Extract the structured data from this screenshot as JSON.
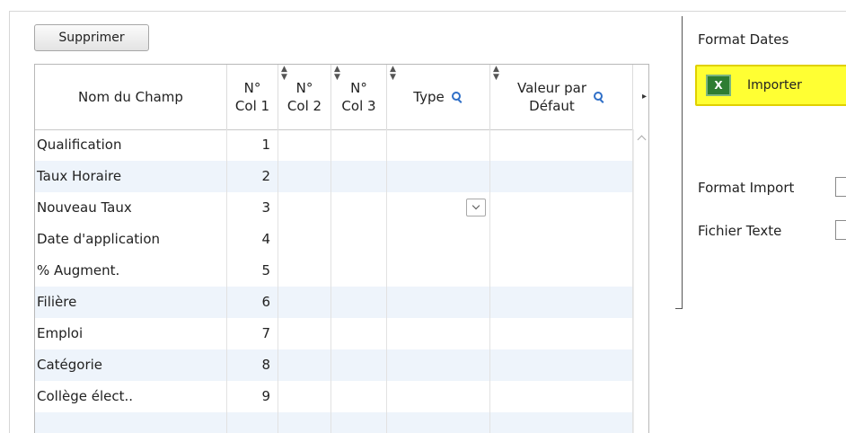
{
  "toolbar": {
    "delete_label": "Supprimer"
  },
  "grid": {
    "columns": {
      "name": "Nom du Champ",
      "col1_line1": "N°",
      "col1_line2": "Col 1",
      "col2_line1": "N°",
      "col2_line2": "Col 2",
      "col3_line1": "N°",
      "col3_line2": "Col 3",
      "type": "Type",
      "default_line1": "Valeur par",
      "default_line2": "Défaut"
    },
    "rows": [
      {
        "name": "Qualification",
        "col1": "1"
      },
      {
        "name": "Taux Horaire",
        "col1": "2"
      },
      {
        "name": "Nouveau Taux",
        "col1": "3"
      },
      {
        "name": "Date d'application",
        "col1": "4"
      },
      {
        "name": "% Augment.",
        "col1": "5"
      },
      {
        "name": "Filière",
        "col1": "6"
      },
      {
        "name": "Emploi",
        "col1": "7"
      },
      {
        "name": "Catégorie",
        "col1": "8"
      },
      {
        "name": "Collège élect..",
        "col1": "9"
      }
    ]
  },
  "right_panel": {
    "format_dates_label": "Format Dates",
    "import_button_label": "Importer",
    "import_icon_text": "X",
    "format_import_label": "Format Import",
    "text_file_label": "Fichier Texte"
  }
}
